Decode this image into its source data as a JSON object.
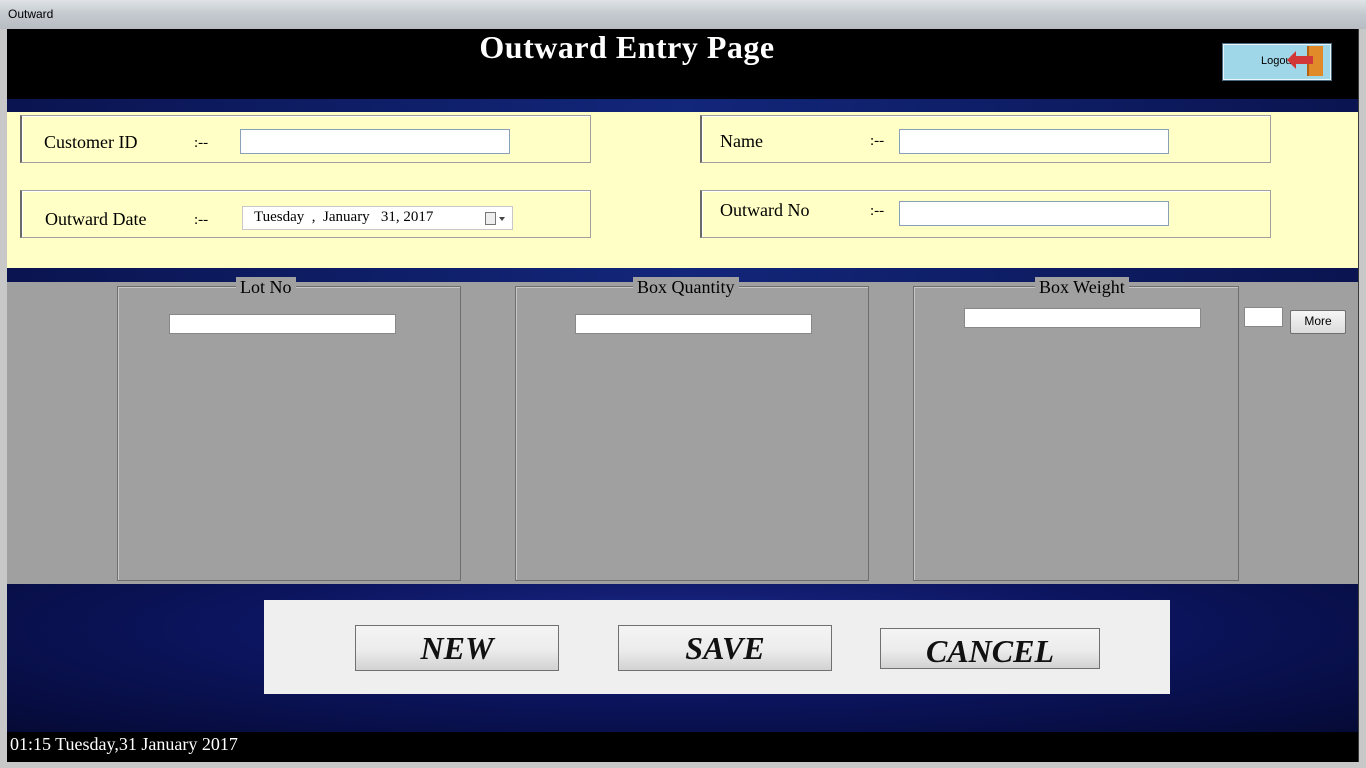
{
  "window": {
    "title": "Outward"
  },
  "header": {
    "title": "Outward Entry Page",
    "logout_label": "Logout"
  },
  "form": {
    "customer_id": {
      "label": "Customer ID",
      "sep": ":--",
      "value": ""
    },
    "name": {
      "label": "Name",
      "sep": ":--",
      "value": ""
    },
    "outward_date": {
      "label": "Outward Date",
      "sep": ":--",
      "value": "Tuesday  ,  January   31, 2017"
    },
    "outward_no": {
      "label": "Outward No",
      "sep": ":--",
      "value": ""
    }
  },
  "groups": {
    "lot_no": {
      "title": "Lot No",
      "value": ""
    },
    "box_quantity": {
      "title": "Box Quantity",
      "value": ""
    },
    "box_weight": {
      "title": "Box Weight",
      "value": ""
    },
    "more_label": "More"
  },
  "actions": {
    "new": "NEW",
    "save": "SAVE",
    "cancel": "CANCEL"
  },
  "status": {
    "datetime": "01:15 Tuesday,31 January 2017"
  },
  "colors": {
    "form_bg": "#ffffc6",
    "header_bg": "#000000",
    "band": "#12267a",
    "grid_bg": "#a0a0a0"
  }
}
